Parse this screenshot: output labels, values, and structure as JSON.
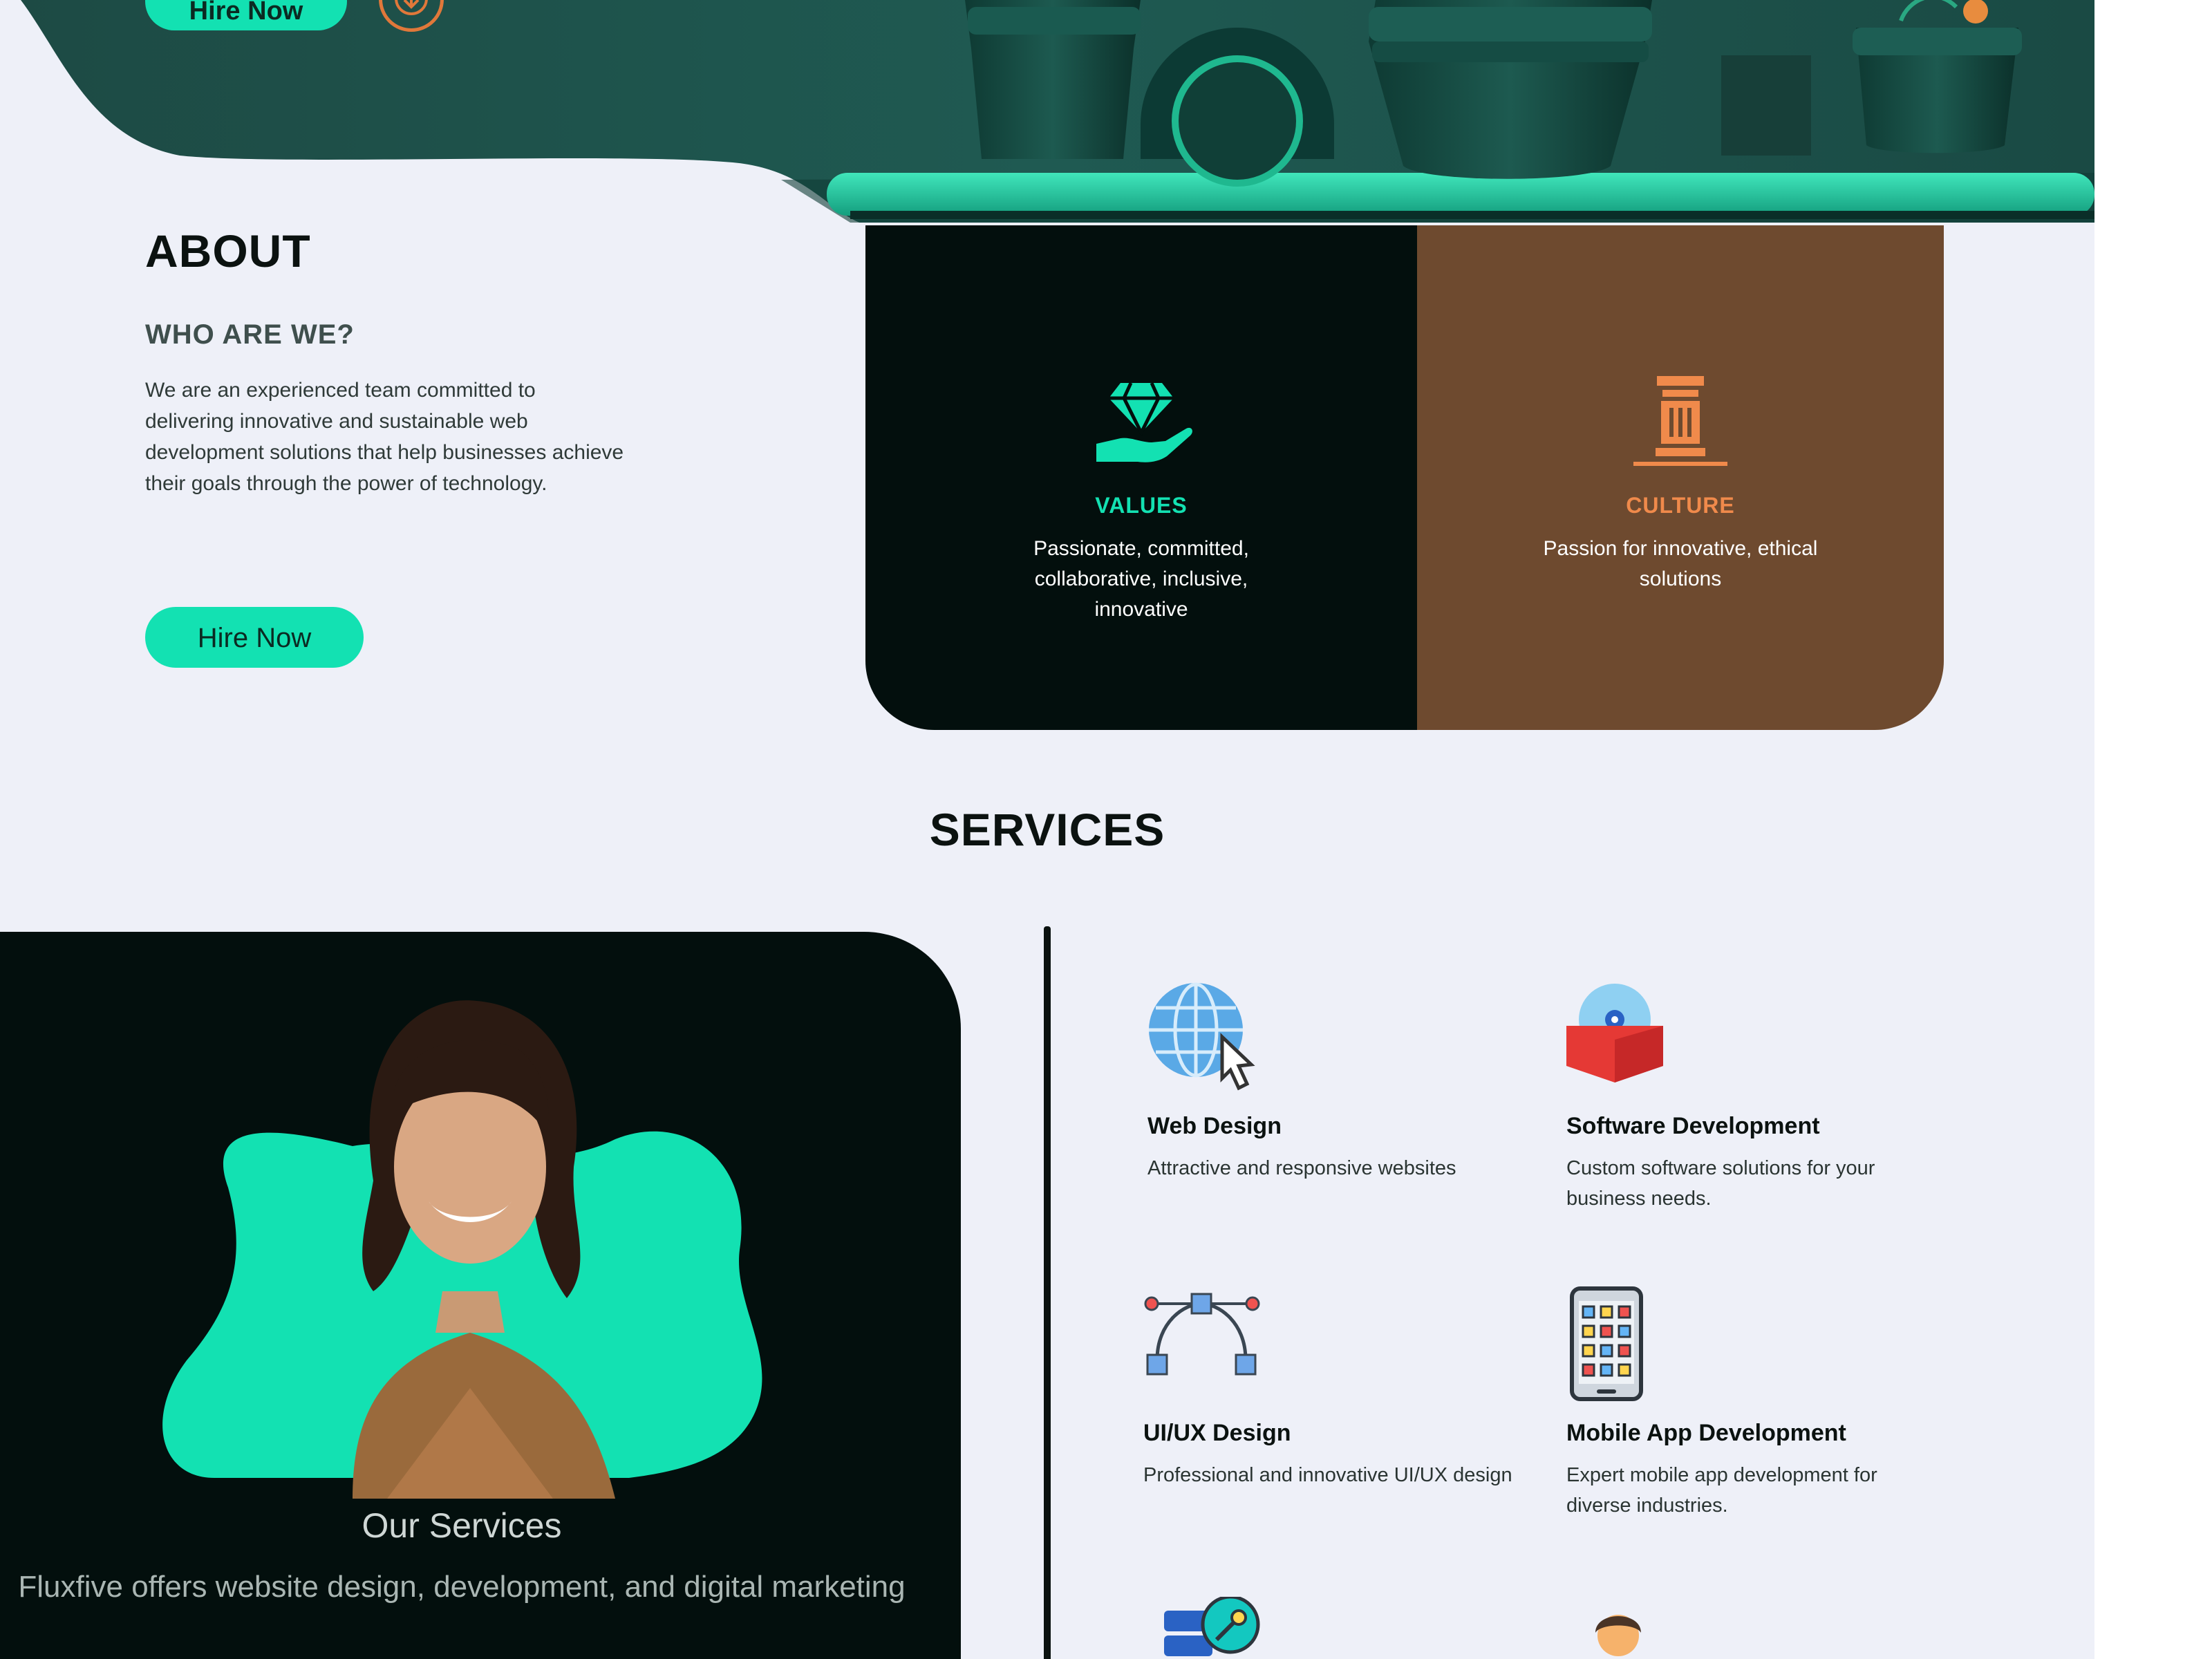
{
  "hero": {
    "hire_label": "Hire Now",
    "download_icon": "arrow-down-icon"
  },
  "about": {
    "title": "ABOUT",
    "subtitle": "WHO ARE WE?",
    "text": "We are an experienced team committed to delivering innovative and sustainable web development solutions that help businesses achieve their goals through the power of technology.",
    "button_label": "Hire Now"
  },
  "cards": [
    {
      "title": "VALUES",
      "text": "Passionate, committed, collaborative, inclusive, innovative",
      "icon": "diamond-hand-icon",
      "color": "#13e1b2"
    },
    {
      "title": "CULTURE",
      "text": "Passion for innovative, ethical solutions",
      "icon": "pillar-icon",
      "color": "#f08a4b"
    }
  ],
  "services": {
    "title": "SERVICES",
    "panel_title": "Our Services",
    "panel_text": "Fluxfive offers website design, development, and digital marketing",
    "items": [
      {
        "name": "Web Design",
        "desc": "Attractive and responsive websites",
        "icon": "globe-cursor-icon"
      },
      {
        "name": "Software Development",
        "desc": "Custom software solutions for your business needs.",
        "icon": "software-box-icon"
      },
      {
        "name": "UI/UX Design",
        "desc": "Professional and innovative UI/UX design",
        "icon": "bezier-pen-icon"
      },
      {
        "name": "Mobile App Development",
        "desc": "Expert mobile app development for diverse industries.",
        "icon": "mobile-app-icon"
      }
    ]
  },
  "colors": {
    "accent": "#13e1b2",
    "dark": "#030f0d",
    "brown": "#6e4a2f",
    "orange": "#f08a4b",
    "background": "#eef0f8"
  }
}
